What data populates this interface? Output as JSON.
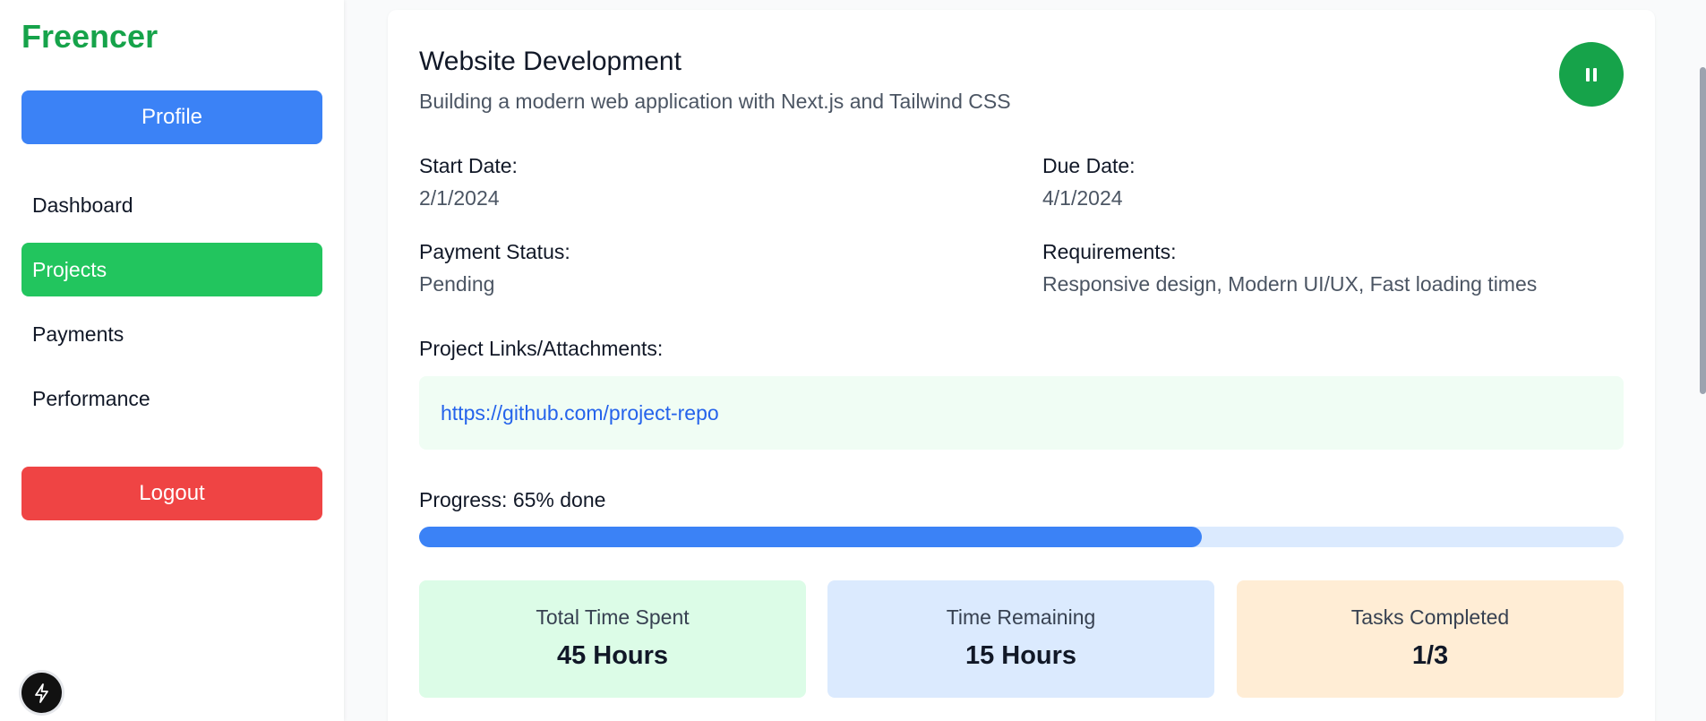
{
  "sidebar": {
    "brand": "Freencer",
    "profile_label": "Profile",
    "nav": [
      {
        "label": "Dashboard",
        "active": false
      },
      {
        "label": "Projects",
        "active": true
      },
      {
        "label": "Payments",
        "active": false
      },
      {
        "label": "Performance",
        "active": false
      }
    ],
    "logout_label": "Logout",
    "bolt_icon": "lightning-icon"
  },
  "project": {
    "title": "Website Development",
    "description": "Building a modern web application with Next.js and Tailwind CSS",
    "pause_icon": "pause-icon",
    "start_date_label": "Start Date:",
    "start_date": "2/1/2024",
    "due_date_label": "Due Date:",
    "due_date": "4/1/2024",
    "payment_status_label": "Payment Status:",
    "payment_status": "Pending",
    "requirements_label": "Requirements:",
    "requirements": "Responsive design, Modern UI/UX, Fast loading times",
    "links_label": "Project Links/Attachments:",
    "link": "https://github.com/project-repo",
    "progress_label": "Progress: 65% done",
    "progress_fraction": 0.65
  },
  "stats": [
    {
      "label": "Total Time Spent",
      "value": "45 Hours"
    },
    {
      "label": "Time Remaining",
      "value": "15 Hours"
    },
    {
      "label": "Tasks Completed",
      "value": "1/3"
    }
  ],
  "colors": {
    "brand": "#16a34a",
    "primary": "#3b82f6",
    "active_nav": "#22c55e",
    "logout": "#ef4444"
  }
}
